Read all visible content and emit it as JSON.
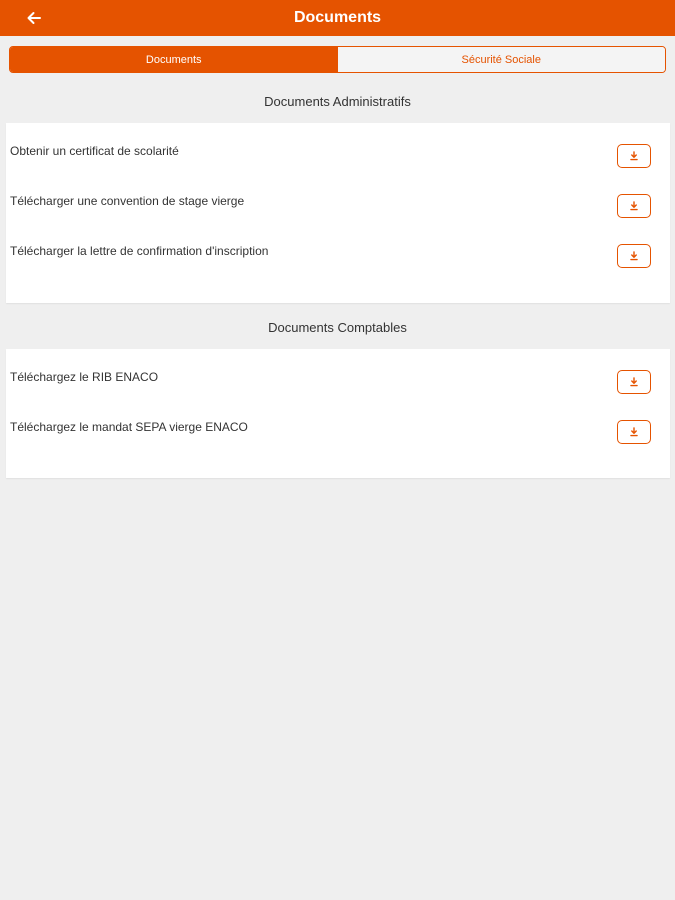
{
  "header": {
    "title": "Documents",
    "back_icon": "arrow-left-icon"
  },
  "tabs": [
    {
      "label": "Documents",
      "active": true
    },
    {
      "label": "Sécurité Sociale",
      "active": false
    }
  ],
  "sections": [
    {
      "title": "Documents Administratifs",
      "items": [
        {
          "label": "Obtenir un certificat de scolarité",
          "icon": "download-icon"
        },
        {
          "label": "Télécharger une convention de stage vierge",
          "icon": "download-icon"
        },
        {
          "label": "Télécharger la lettre de confirmation d'inscription",
          "icon": "download-icon"
        }
      ]
    },
    {
      "title": "Documents Comptables",
      "items": [
        {
          "label": "Téléchargez le RIB ENACO",
          "icon": "download-icon"
        },
        {
          "label": "Téléchargez le mandat SEPA vierge ENACO",
          "icon": "download-icon"
        }
      ]
    }
  ],
  "colors": {
    "accent": "#e55300",
    "background": "#efefef",
    "card": "#ffffff",
    "text": "#333333"
  }
}
